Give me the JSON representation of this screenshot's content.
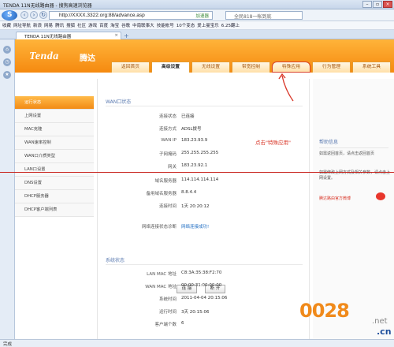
{
  "window": {
    "title": "TENDA 11N无线路由器 - 搜狗高速浏览器",
    "buttons": [
      "–",
      "▫",
      "×"
    ]
  },
  "address_bar": {
    "url": "http://XXXX.3322.org:88/advance.asp",
    "speed_label": "加速器",
    "search_placeholder": "全民818一帐到底"
  },
  "bookmarks": [
    "收藏",
    "网址导航",
    "新浪",
    "网易",
    "腾讯",
    "搜狐",
    "社区",
    "游戏",
    "百度",
    "淘宝",
    "谷歌",
    "中南联事大",
    "技能帐号",
    "10个变态",
    "爱上曼宝乐",
    "6.25翻上"
  ],
  "tab": {
    "label": "TENDA 11N无线路由器",
    "close": "×",
    "new": "+"
  },
  "router": {
    "brand": "Tenda",
    "brand_cn": "腾达",
    "nav": [
      "返回首页",
      "高级设置",
      "无线设置",
      "带宽控制",
      "特殊应用",
      "行为管理",
      "系统工具"
    ],
    "active_nav": "高级设置",
    "sidenav": [
      "运行状态",
      "上网设置",
      "MAC克隆",
      "WAN速率控制",
      "WAN口介质类型",
      "LAN口设置",
      "DNS设置",
      "DHCP服务器",
      "DHCP客户端列表"
    ],
    "wan": {
      "title": "WAN口状态",
      "rows": [
        {
          "label": "连接状态",
          "value": "已连接"
        },
        {
          "label": "连接方式",
          "value": "ADSL拨号"
        },
        {
          "label": "WAN IP",
          "value": "183.23.93.9"
        },
        {
          "label": "子网掩码",
          "value": "255.255.255.255"
        },
        {
          "label": "网关",
          "value": "183.23.92.1"
        },
        {
          "label": "域名服务器",
          "value": "114.114.114.114"
        },
        {
          "label": "备用域名服务器",
          "value": "8.8.4.4"
        },
        {
          "label": "连接时间",
          "value": "1天 20:20:12"
        },
        {
          "label": "网络连接状态诊断",
          "value": "网络连接成功!"
        }
      ],
      "btn_connect": "连 接",
      "btn_disconnect": "断 开"
    },
    "system": {
      "title": "系统状态",
      "rows": [
        {
          "label": "LAN MAC 地址",
          "value": "C8:3A:35:38:F2:70"
        },
        {
          "label": "WAN MAC 地址",
          "value": "00:00:31:00:00:00"
        },
        {
          "label": "系统时间",
          "value": "2011-04-04 20:15:06"
        },
        {
          "label": "运行时间",
          "value": "3天 20:15:06"
        },
        {
          "label": "客户端个数",
          "value": "6"
        }
      ]
    },
    "annotation": "点击\"特殊应用\"",
    "help": {
      "title": "帮助信息",
      "text1": "如需返回首页，请点击返回首页",
      "text2": "如需修改上网方式及相关参数，请点击上网设置。",
      "weibo": "腾达路由官方微博"
    }
  },
  "status": "完成",
  "watermark": {
    "num": "0028",
    "net": ".net",
    "cn": ".cn"
  },
  "colors": {
    "orange": "#f58a10",
    "red": "#d9382a",
    "blue": "#1d6cc2"
  }
}
